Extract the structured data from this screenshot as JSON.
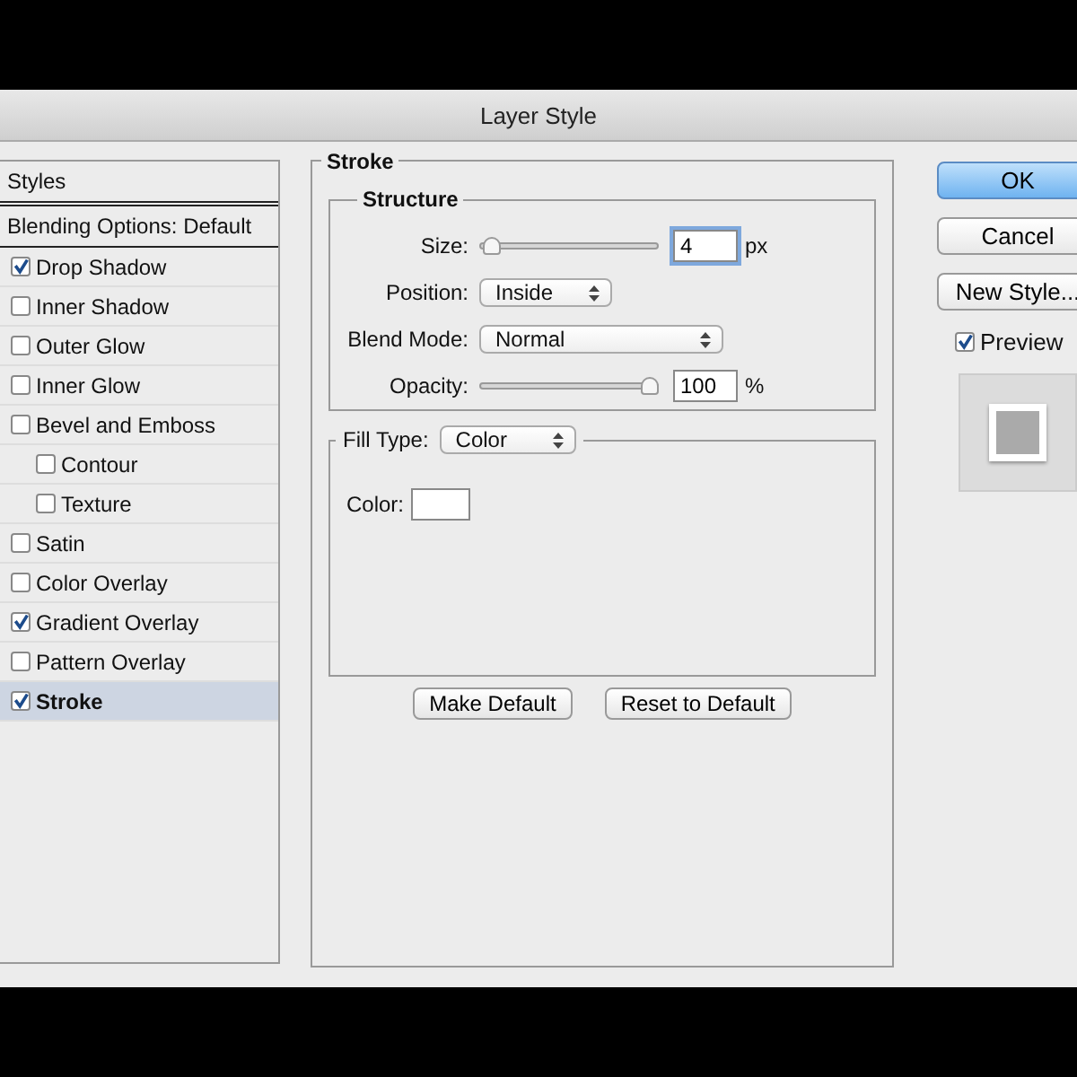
{
  "window": {
    "title": "Layer Style"
  },
  "sidebar": {
    "header": "Styles",
    "blending": "Blending Options: Default",
    "items": [
      {
        "label": "Drop Shadow",
        "checked": true,
        "selected": false
      },
      {
        "label": "Inner Shadow",
        "checked": false,
        "selected": false
      },
      {
        "label": "Outer Glow",
        "checked": false,
        "selected": false
      },
      {
        "label": "Inner Glow",
        "checked": false,
        "selected": false
      },
      {
        "label": "Bevel and Emboss",
        "checked": false,
        "selected": false,
        "children": [
          {
            "label": "Contour",
            "checked": false,
            "selected": false
          },
          {
            "label": "Texture",
            "checked": false,
            "selected": false
          }
        ]
      },
      {
        "label": "Satin",
        "checked": false,
        "selected": false
      },
      {
        "label": "Color Overlay",
        "checked": false,
        "selected": false
      },
      {
        "label": "Gradient Overlay",
        "checked": true,
        "selected": false
      },
      {
        "label": "Pattern Overlay",
        "checked": false,
        "selected": false
      },
      {
        "label": "Stroke",
        "checked": true,
        "selected": true
      }
    ]
  },
  "stroke": {
    "title": "Stroke",
    "structure": {
      "title": "Structure",
      "size": {
        "label": "Size:",
        "level": 0.02,
        "value": "4",
        "unit": "px"
      },
      "position": {
        "label": "Position:",
        "value": "Inside"
      },
      "blend_mode": {
        "label": "Blend Mode:",
        "value": "Normal"
      },
      "opacity": {
        "label": "Opacity:",
        "level": 1,
        "value": "100",
        "unit": "%"
      }
    },
    "fill": {
      "label": "Fill Type:",
      "value": "Color",
      "color_label": "Color:",
      "color": "#ffffff"
    },
    "buttons": [
      "Make Default",
      "Reset to Default"
    ]
  },
  "actions": {
    "ok": "OK",
    "cancel": "Cancel",
    "new_style": "New Style...",
    "preview": {
      "label": "Preview",
      "checked": true
    }
  }
}
